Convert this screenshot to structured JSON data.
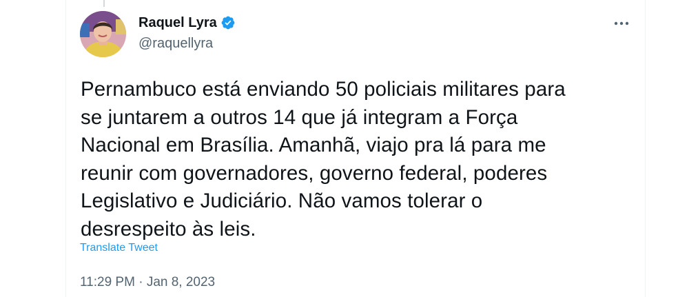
{
  "author": {
    "display_name": "Raquel Lyra",
    "handle": "@raquellyra",
    "avatar_icon": "profile-photo",
    "verified_icon": "verified-badge-icon"
  },
  "tweet": {
    "lines": [
      "Pernambuco está enviando 50 policiais militares para",
      "se juntarem a outros 14 que já integram a Força",
      "Nacional em Brasília. Amanhã, viajo pra lá para me",
      "reunir com governadores, governo federal, poderes",
      "Legislativo e Judiciário. Não vamos tolerar o",
      "desrespeito às leis."
    ],
    "translate_label": "Translate Tweet",
    "time": "11:29 PM",
    "separator": "·",
    "date": "Jan 8, 2023"
  },
  "colors": {
    "text": "#0f1419",
    "secondary": "#536471",
    "accent": "#1d9bf0"
  }
}
